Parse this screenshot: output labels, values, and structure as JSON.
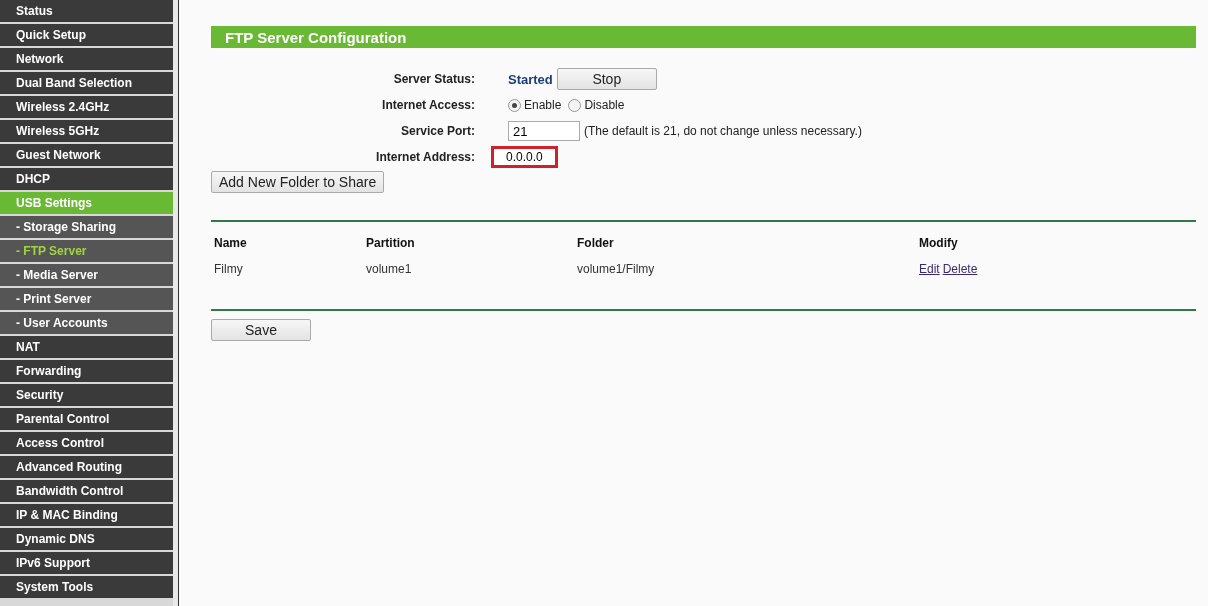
{
  "sidebar": {
    "items": [
      {
        "label": "Status",
        "kind": "main",
        "selected": false
      },
      {
        "label": "Quick Setup",
        "kind": "main",
        "selected": false
      },
      {
        "label": "Network",
        "kind": "main",
        "selected": false
      },
      {
        "label": "Dual Band Selection",
        "kind": "main",
        "selected": false
      },
      {
        "label": "Wireless 2.4GHz",
        "kind": "main",
        "selected": false
      },
      {
        "label": "Wireless 5GHz",
        "kind": "main",
        "selected": false
      },
      {
        "label": "Guest Network",
        "kind": "main",
        "selected": false
      },
      {
        "label": "DHCP",
        "kind": "main",
        "selected": false
      },
      {
        "label": "USB Settings",
        "kind": "main",
        "selected": true
      },
      {
        "label": "- Storage Sharing",
        "kind": "sub",
        "selected": false
      },
      {
        "label": "- FTP Server",
        "kind": "sub",
        "selected": true
      },
      {
        "label": "- Media Server",
        "kind": "sub",
        "selected": false
      },
      {
        "label": "- Print Server",
        "kind": "sub",
        "selected": false
      },
      {
        "label": "- User Accounts",
        "kind": "sub",
        "selected": false
      },
      {
        "label": "NAT",
        "kind": "main",
        "selected": false
      },
      {
        "label": "Forwarding",
        "kind": "main",
        "selected": false
      },
      {
        "label": "Security",
        "kind": "main",
        "selected": false
      },
      {
        "label": "Parental Control",
        "kind": "main",
        "selected": false
      },
      {
        "label": "Access Control",
        "kind": "main",
        "selected": false
      },
      {
        "label": "Advanced Routing",
        "kind": "main",
        "selected": false
      },
      {
        "label": "Bandwidth Control",
        "kind": "main",
        "selected": false
      },
      {
        "label": "IP & MAC Binding",
        "kind": "main",
        "selected": false
      },
      {
        "label": "Dynamic DNS",
        "kind": "main",
        "selected": false
      },
      {
        "label": "IPv6 Support",
        "kind": "main",
        "selected": false
      },
      {
        "label": "System Tools",
        "kind": "main",
        "selected": false
      }
    ]
  },
  "panel": {
    "title": "FTP Server Configuration",
    "server_status": {
      "label": "Server Status:",
      "value": "Started",
      "button": "Stop"
    },
    "internet_access": {
      "label": "Internet Access:",
      "options": [
        {
          "label": "Enable",
          "selected": true
        },
        {
          "label": "Disable",
          "selected": false
        }
      ]
    },
    "service_port": {
      "label": "Service Port:",
      "value": "21",
      "hint": "(The default is 21, do not change unless necessary.)"
    },
    "internet_address": {
      "label": "Internet Address:",
      "value": "0.0.0.0",
      "highlighted": true
    },
    "add_button": "Add New Folder to Share",
    "table": {
      "columns": [
        "Name",
        "Partition",
        "Folder",
        "Modify"
      ],
      "rows": [
        {
          "name": "Filmy",
          "partition": "volume1",
          "folder": "volume1/Filmy",
          "actions": [
            "Edit",
            "Delete"
          ]
        }
      ]
    },
    "save_button": "Save"
  }
}
